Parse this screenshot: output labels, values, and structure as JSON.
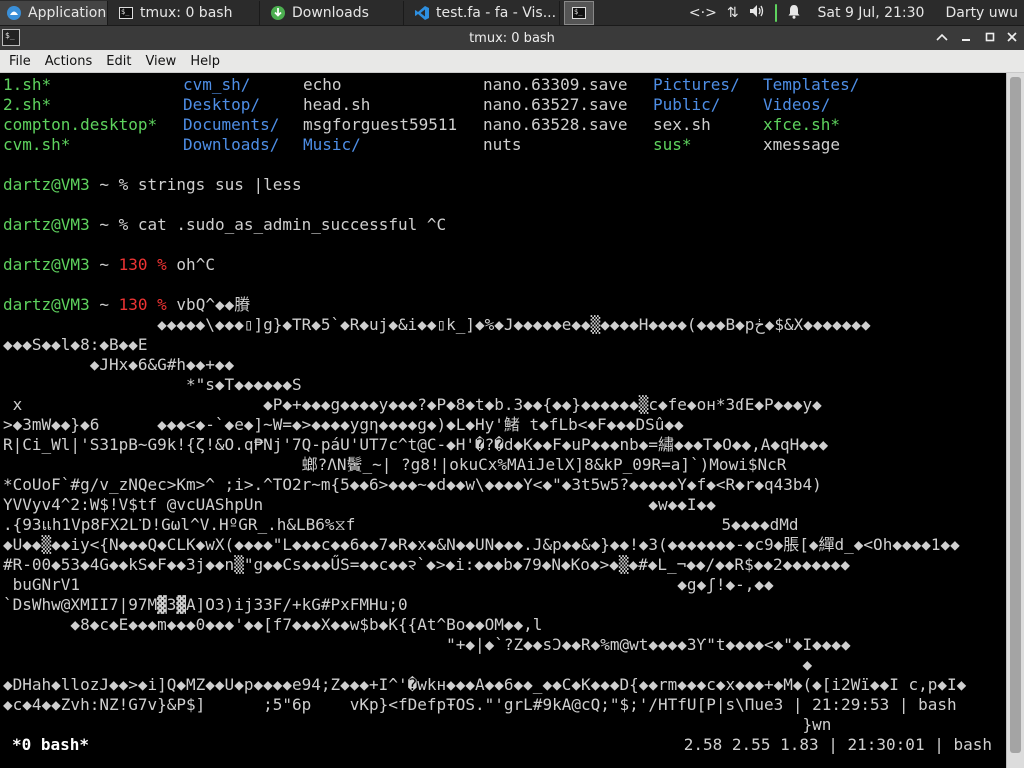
{
  "panel": {
    "apps_label": "Applications",
    "tasks": {
      "tmux": "tmux: 0 bash",
      "downloads": "Downloads",
      "vscode": "test.fa - fa - Vis..."
    },
    "clock": "Sat  9 Jul, 21:30",
    "user": "Darty uwu",
    "icons": [
      "network-icon",
      "transfer-icon",
      "volume-icon",
      "battery-icon",
      "bell-icon"
    ]
  },
  "window": {
    "title": "tmux: 0 bash",
    "menu": [
      "File",
      "Actions",
      "Edit",
      "View",
      "Help"
    ]
  },
  "terminal": {
    "ls_rows": [
      [
        "1.sh*",
        "cvm_sh/",
        "echo",
        "nano.63309.save",
        "Pictures/",
        "Templates/"
      ],
      [
        "2.sh*",
        "Desktop/",
        "head.sh",
        "nano.63527.save",
        "Public/",
        "Videos/"
      ],
      [
        "compton.desktop*",
        "Documents/",
        "msgforguest59511",
        "nano.63528.save",
        "sex.sh",
        "xfce.sh*"
      ],
      [
        "cvm.sh*",
        "Downloads/",
        "Music/",
        "nuts",
        "sus*",
        "xmessage"
      ]
    ],
    "prompt_user": "dartz@VM3",
    "prompt_rest": " ~ ",
    "prompt_sign": "% ",
    "cmd1": "strings sus |less",
    "cmd2": "cat .sudo_as_admin_successful ^C",
    "exit_code": "130",
    "cmd3": "oh^C",
    "cmd4": "vbQ^◆◆賸",
    "garbage": [
      "                ◆◆◆◆◆\\◆◆◆▯]g}◆TR◆5`◆R◆uj◆&i◆◆▯k_]◆%◆J◆◆◆◆◆e◆◆▒◆◆◆◆H◆◆◆◆(◆◆◆B◆pڂ◆$&X◆◆◆◆◆◆◆",
      "◆◆◆S◆◆l◆8:◆B◆◆E",
      "         ◆JHx◆6&G#h◆◆+◆◆",
      "                   *\"s◆T◆◆◆◆◆◆S",
      " x                         ◆P◆+◆◆◆g◆◆◆◆y◆◆◆?◆P◆8◆t◆b.3◆◆{◆◆}◆◆◆◆◆◆▒c◆fe◆oн*3ɗE◆P◆◆◆y◆",
      ">◆3mW◆◆}◆6      ◆◆◆<◆-`◆e◆]~W=◆>◆◆◆◆ygη◆◆◆◆g◆)◆L◆Hy'鯺 t◆fLb<◆F◆◆◆DSû◆◆",
      "R|Ci_Wl|'S31pB~G9k!{ζ!&O.q₱Nj'7Q-páU'UT7c^t@C-◆H'�?�d◆K◆◆F◆uP◆◆◆nb◆=繡◆◆◆T◆O◆◆,A◆qH◆◆◆",
      "                               螂?ΛN鬢_~| ?g8!|okuCx%MAiJelX]8&kP_09R=a]`)Mowi$NcR",
      "*CoUoF`#g/v_zNQec>Km>^ ;i>.^TO2r~m{5◆◆6>◆◆◆~◆d◆◆w\\◆◆◆◆Y<◆\"◆3t5w5?◆◆◆◆◆Y◆f◆<R◆r◆q43b4)",
      "YVVyv4^2:W$!V$tf @vcUAShpUn                                        ◆w◆◆I◆◆",
      ".{93แh1Vp8FX2L་D!Gωl^V.HºGR_.h&LB6%⧖f                                      5◆◆◆◆dMd",
      "◆U◆◆▒◆◆iy<{N◆◆◆Q◆CLK◆wX(◆◆◆◆\"L◆◆◆c◆◆6◆◆7◆R◆x◆&N◆◆UN◆◆◆.J&p◆◆&◆}◆◆!◆3(◆◆◆◆◆◆◆-◆c9◆脹[◆繟d_◆<Oh◆◆◆◆1◆◆",
      "#R-00◆53◆4G◆◆kS◆F◆◆3j◆◆n▒\"g◆◆Cs◆◆◆ŰS=◆◆c◆◆᱂`◆>◆i:◆◆◆b◆79◆N◆Ko◆>◆▒◆#◆L_¬◆◆/◆◆R$◆◆2◆◆◆◆◆◆◆",
      " buGNrV1                                                              ◆g◆ʃ!◆-,◆◆",
      "`DsWhw@XMII7|97M▓3▓A]O3)ij33F/+kG#PxFMHu;0",
      "       ◆8◆c◆E◆◆◆m◆◆◆0◆◆◆'◆◆[f7◆◆◆X◆◆w$b◆K{{At^Bo◆◆OM◆◆,l",
      "                                              \"+◆∣◆`?Z◆◆sƆ◆◆R◆%m@wt◆◆◆◆3Ƴ\"t◆◆◆◆<◆\"◆I◆◆◆◆",
      "                                                                                   ◆",
      "◆DHah◆llozJ◆◆>◆i]Q◆MZ◆◆U◆p◆◆◆◆e94;Z◆◆◆+I^'�wkн◆◆◆A◆◆6◆◆_◆◆C◆K◆◆◆D{◆◆rm◆◆◆c◆x◆◆◆+◆M◆(◆[i2Wï◆◆I c,p◆I◆",
      "◆c◆4◆◆Zvh:NZ!G7v}&P$]      ;5\"6p    vKp}<fDefpŦOS.\"'grL#9kA@cQ;\"$;'/HTfU[P|s\\Πue3 | 21:29:53 | bash",
      "                                                                                   }wn"
    ],
    "status_left": "*0 bash*",
    "status_right": "2.58 2.55 1.83 | 21:30:01 | bash"
  }
}
